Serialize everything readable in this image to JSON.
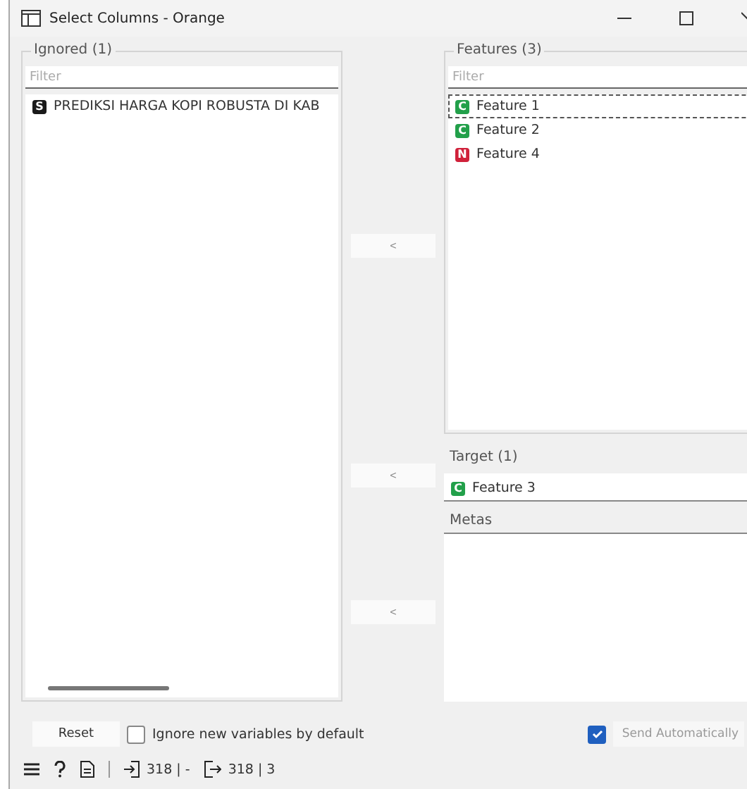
{
  "window": {
    "title": "Select Columns - Orange"
  },
  "ignored": {
    "title": "Ignored (1)",
    "filter": {
      "placeholder": "Filter"
    },
    "items": [
      {
        "letter": "S",
        "color": "#1a1a1a",
        "name": "PREDIKSI HARGA KOPI ROBUSTA DI KAB",
        "selected": false
      }
    ]
  },
  "features": {
    "title": "Features (3)",
    "filter": {
      "placeholder": "Filter"
    },
    "move_button": "<",
    "items": [
      {
        "letter": "C",
        "color": "#22a04a",
        "name": "Feature 1",
        "selected": true
      },
      {
        "letter": "C",
        "color": "#22a04a",
        "name": "Feature 2",
        "selected": false
      },
      {
        "letter": "N",
        "color": "#d0213a",
        "name": "Feature 4",
        "selected": false
      }
    ]
  },
  "target": {
    "title": "Target (1)",
    "move_button": "<",
    "items": [
      {
        "letter": "C",
        "color": "#22a04a",
        "name": "Feature 3",
        "selected": false
      }
    ]
  },
  "metas": {
    "title": "Metas",
    "move_button": "<"
  },
  "reset_button": "Reset",
  "ignore_new": {
    "label": "Ignore new variables by default",
    "checked": false
  },
  "send_auto": {
    "label": "Send Automatically",
    "checked": true
  },
  "status_bar": {
    "input": "318 | -",
    "output": "318 | 3"
  }
}
